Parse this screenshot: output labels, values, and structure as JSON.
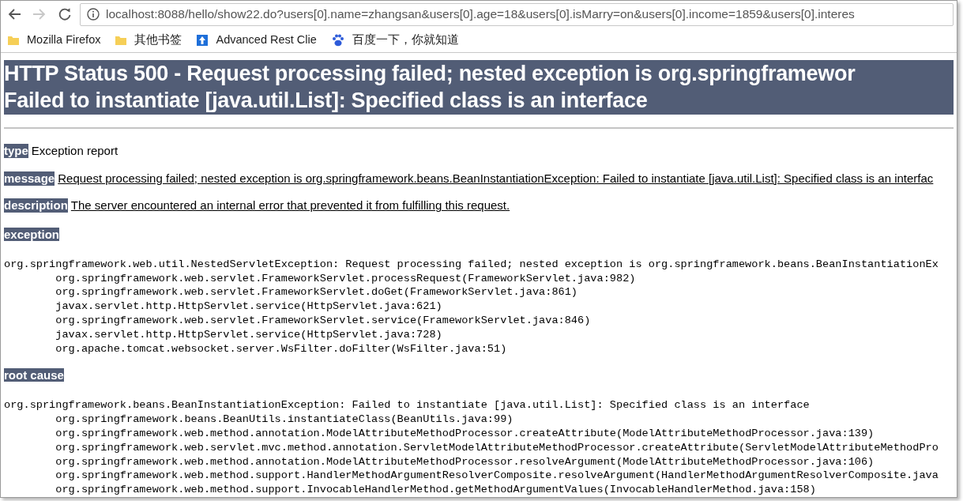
{
  "toolbar": {
    "back": {
      "disabled": false
    },
    "forward": {
      "disabled": true
    },
    "url": "localhost:8088/hello/show22.do?users[0].name=zhangsan&users[0].age=18&users[0].isMarry=on&users[0].income=1859&users[0].interes"
  },
  "bookmarks": [
    {
      "kind": "folder",
      "label": "Mozilla Firefox"
    },
    {
      "kind": "folder",
      "label": "其他书签"
    },
    {
      "kind": "app",
      "label": "Advanced Rest Clie"
    },
    {
      "kind": "paw",
      "label": "百度一下，你就知道"
    }
  ],
  "heading": [
    "HTTP Status 500 - Request processing failed; nested exception is org.springframewor",
    "Failed to instantiate [java.util.List]: Specified class is an interface"
  ],
  "fields": [
    {
      "label": "type",
      "text": "Exception report",
      "underlined": false
    },
    {
      "label": "message",
      "text": "Request processing failed; nested exception is org.springframework.beans.BeanInstantiationException: Failed to instantiate [java.util.List]: Specified class is an interfac",
      "underlined": true
    },
    {
      "label": "description",
      "text": "The server encountered an internal error that prevented it from fulfilling this request.",
      "underlined": true
    }
  ],
  "sections": [
    {
      "label": "exception",
      "lines": [
        "org.springframework.web.util.NestedServletException: Request processing failed; nested exception is org.springframework.beans.BeanInstantiationEx",
        "\torg.springframework.web.servlet.FrameworkServlet.processRequest(FrameworkServlet.java:982)",
        "\torg.springframework.web.servlet.FrameworkServlet.doGet(FrameworkServlet.java:861)",
        "\tjavax.servlet.http.HttpServlet.service(HttpServlet.java:621)",
        "\torg.springframework.web.servlet.FrameworkServlet.service(FrameworkServlet.java:846)",
        "\tjavax.servlet.http.HttpServlet.service(HttpServlet.java:728)",
        "\torg.apache.tomcat.websocket.server.WsFilter.doFilter(WsFilter.java:51)"
      ]
    },
    {
      "label": "root cause",
      "lines": [
        "org.springframework.beans.BeanInstantiationException: Failed to instantiate [java.util.List]: Specified class is an interface",
        "\torg.springframework.beans.BeanUtils.instantiateClass(BeanUtils.java:99)",
        "\torg.springframework.web.method.annotation.ModelAttributeMethodProcessor.createAttribute(ModelAttributeMethodProcessor.java:139)",
        "\torg.springframework.web.servlet.mvc.method.annotation.ServletModelAttributeMethodProcessor.createAttribute(ServletModelAttributeMethodPro",
        "\torg.springframework.web.method.annotation.ModelAttributeMethodProcessor.resolveArgument(ModelAttributeMethodProcessor.java:106)",
        "\torg.springframework.web.method.support.HandlerMethodArgumentResolverComposite.resolveArgument(HandlerMethodArgumentResolverComposite.java",
        "\torg.springframework.web.method.support.InvocableHandlerMethod.getMethodArgumentValues(InvocableHandlerMethod.java:158)"
      ]
    }
  ]
}
